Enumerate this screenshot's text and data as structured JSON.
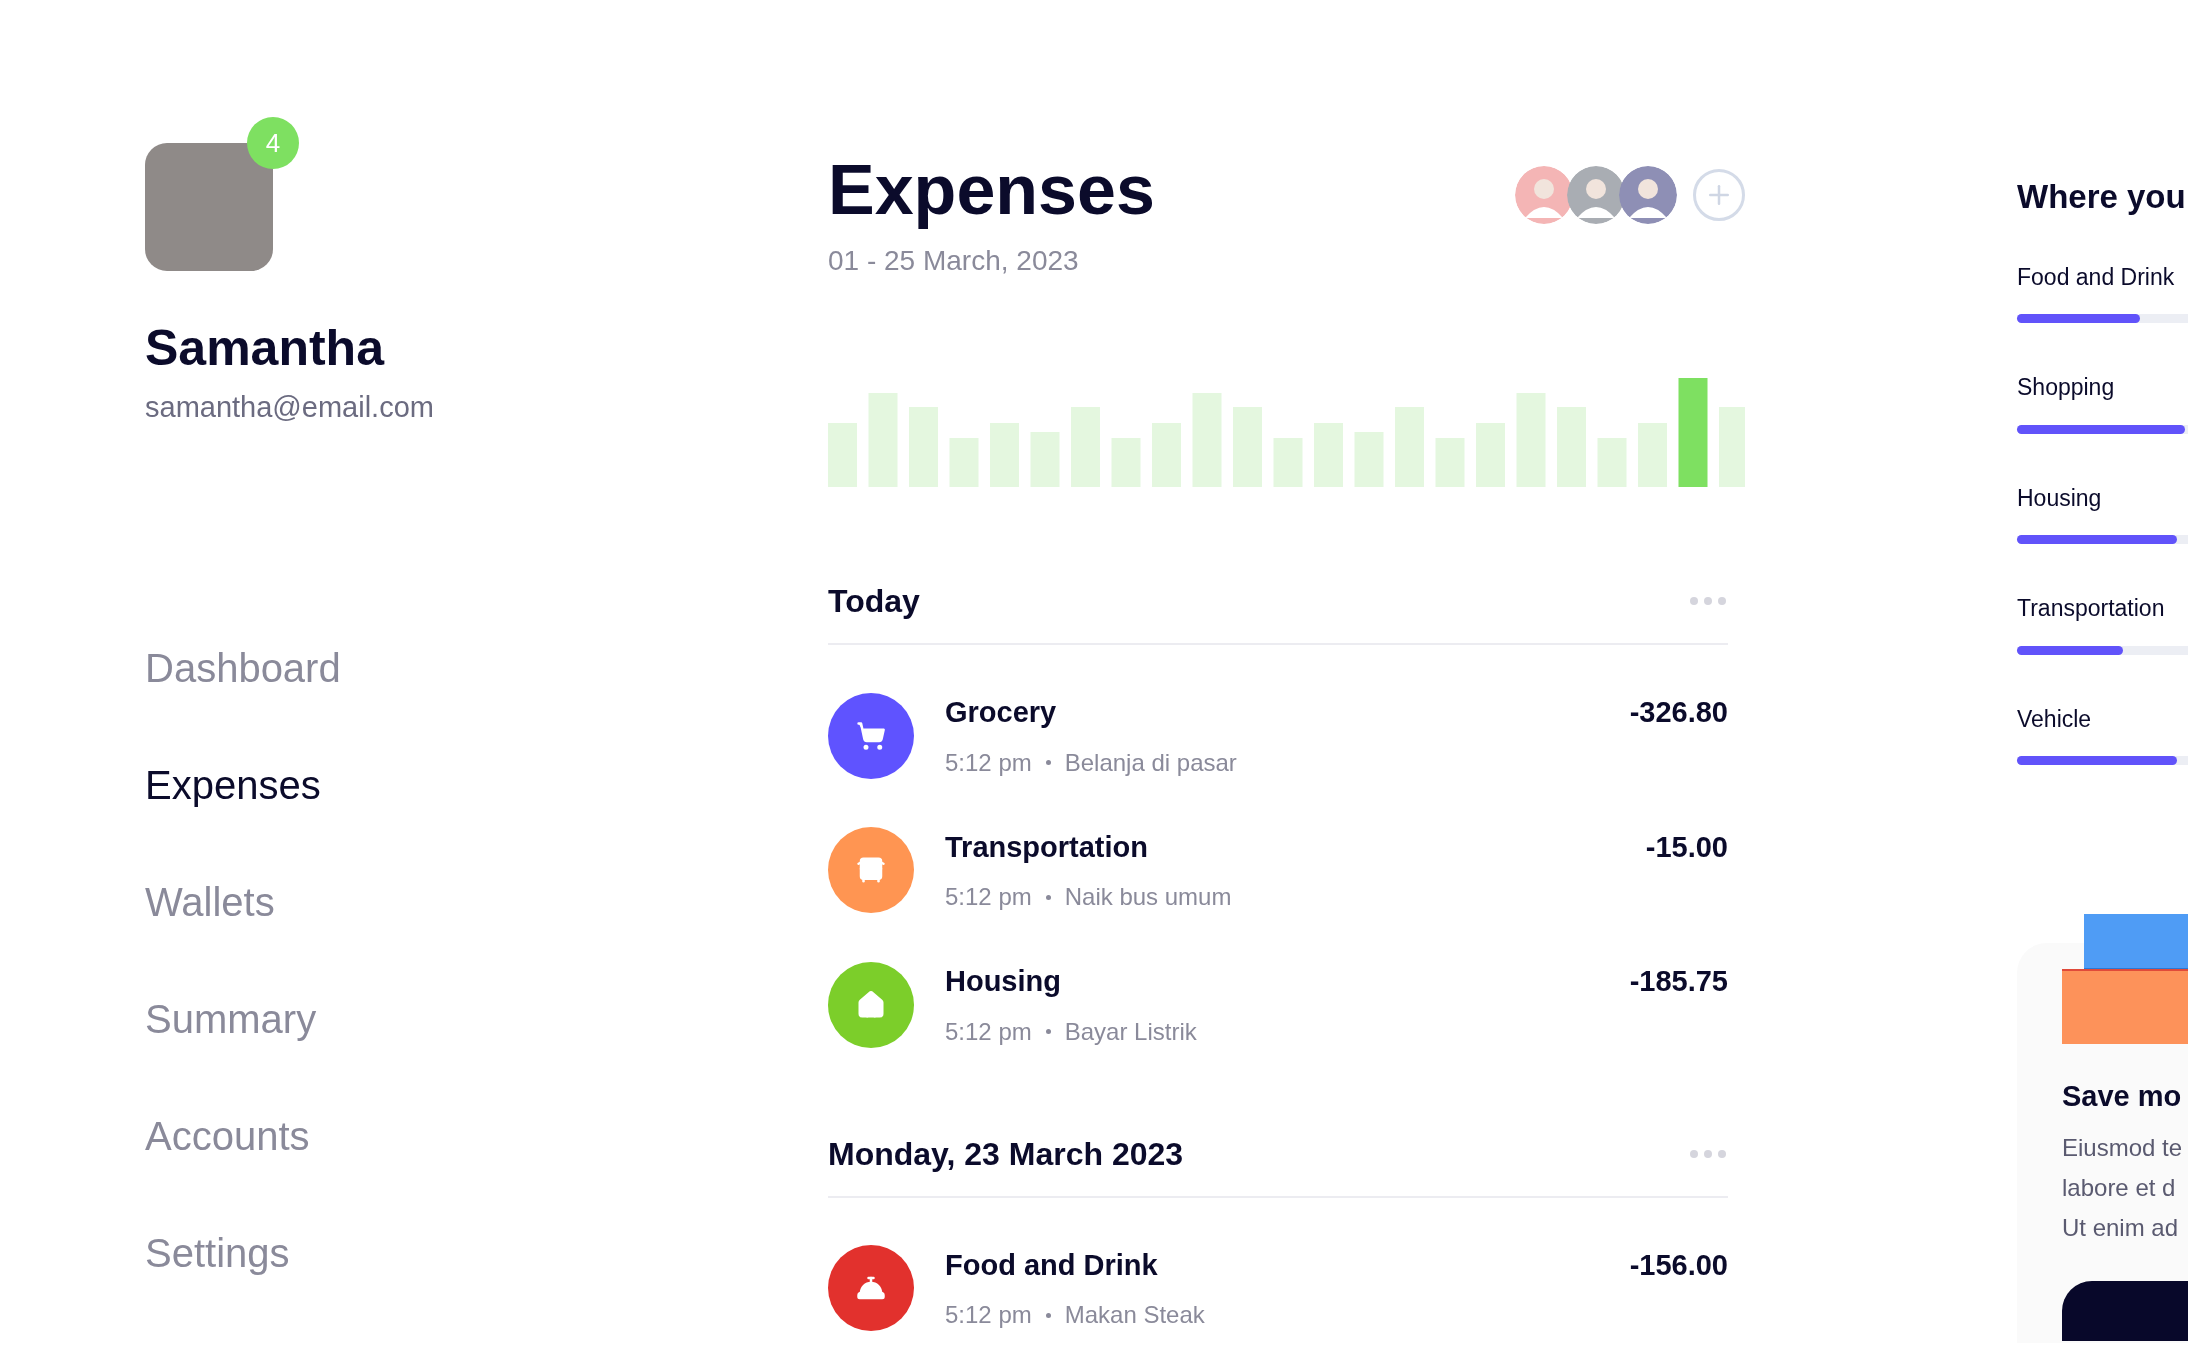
{
  "profile": {
    "name": "Samantha",
    "email": "samantha@email.com",
    "notification_count": "4"
  },
  "nav": [
    {
      "label": "Dashboard",
      "selected": false
    },
    {
      "label": "Expenses",
      "selected": true
    },
    {
      "label": "Wallets",
      "selected": false
    },
    {
      "label": "Summary",
      "selected": false
    },
    {
      "label": "Accounts",
      "selected": false
    },
    {
      "label": "Settings",
      "selected": false
    }
  ],
  "header": {
    "title": "Expenses",
    "date": "01 - 25 March, 2023"
  },
  "sections": [
    {
      "title": "Today",
      "transactions": [
        {
          "kind": "grocery",
          "color": "#5f53ff",
          "title": "Grocery",
          "time": "5:12 pm",
          "note": "Belanja di pasar",
          "amount": "-326.80"
        },
        {
          "kind": "transport",
          "color": "#ff9552",
          "title": "Transportation",
          "time": "5:12 pm",
          "note": "Naik bus umum",
          "amount": "-15.00"
        },
        {
          "kind": "housing",
          "color": "#7cce2a",
          "title": "Housing",
          "time": "5:12 pm",
          "note": "Bayar Listrik",
          "amount": "-185.75"
        }
      ]
    },
    {
      "title": "Monday, 23 March 2023",
      "transactions": [
        {
          "kind": "food",
          "color": "#e2312d",
          "title": "Food and Drink",
          "time": "5:12 pm",
          "note": "Makan Steak",
          "amount": "-156.00"
        }
      ]
    }
  ],
  "spending": {
    "title": "Where you",
    "categories": [
      {
        "label": "Food and Drink",
        "level": 0.44
      },
      {
        "label": "Shopping",
        "level": 0.6
      },
      {
        "label": "Housing",
        "level": 0.57
      },
      {
        "label": "Transportation",
        "level": 0.38
      },
      {
        "label": "Vehicle",
        "level": 0.57
      }
    ]
  },
  "promo": {
    "title": "Save mo",
    "lines": [
      "Eiusmod te",
      "labore et d",
      "Ut enim ad"
    ]
  }
}
